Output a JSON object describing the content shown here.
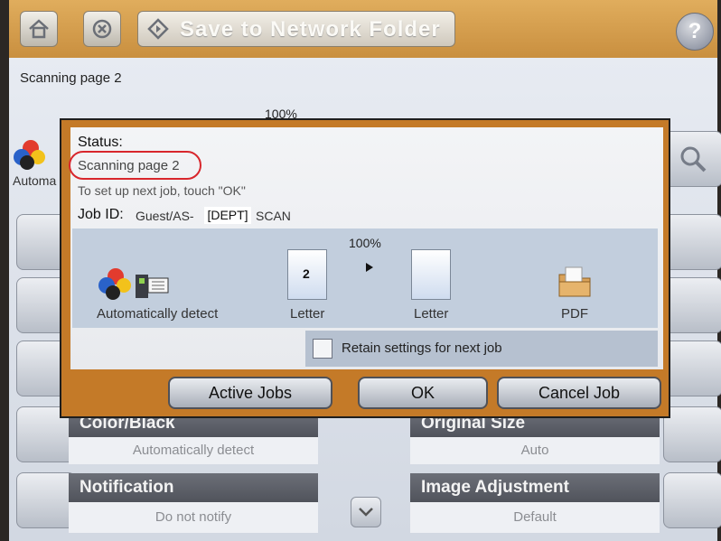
{
  "topbar": {
    "title": "Save to Network Folder",
    "help_icon": "question-mark-icon",
    "help_glyph": "?"
  },
  "background": {
    "scan_status": "Scanning page 2",
    "progress_text": "100%",
    "color_label_partial": "Automa",
    "sections": {
      "color_black": {
        "title": "Color/Black",
        "value": "Automatically detect"
      },
      "original_size": {
        "title": "Original Size",
        "value": "Auto"
      },
      "notification": {
        "title": "Notification",
        "value": "Do not notify"
      },
      "image_adjustment": {
        "title": "Image Adjustment",
        "value": "Default"
      }
    }
  },
  "dialog": {
    "status_label": "Status:",
    "status_value": "Scanning page 2",
    "instruction": "To set up next job, touch \"OK\"",
    "job_id_label": "Job ID:",
    "job_id_prefix": "Guest/AS-",
    "job_id_dept": "[DEPT]",
    "job_id_suffix": "SCAN",
    "progress": "100%",
    "page_number": "2",
    "color_mode": "Automatically detect",
    "source_size": "Letter",
    "output_size": "Letter",
    "file_type": "PDF",
    "retain_label": "Retain settings for next job",
    "retain_checked": false,
    "buttons": {
      "active_jobs": "Active Jobs",
      "ok": "OK",
      "cancel": "Cancel Job"
    }
  },
  "colors": {
    "accent_orange": "#c47a28",
    "highlight_red": "#d8262c",
    "dark_bar": "#5b5e66"
  }
}
